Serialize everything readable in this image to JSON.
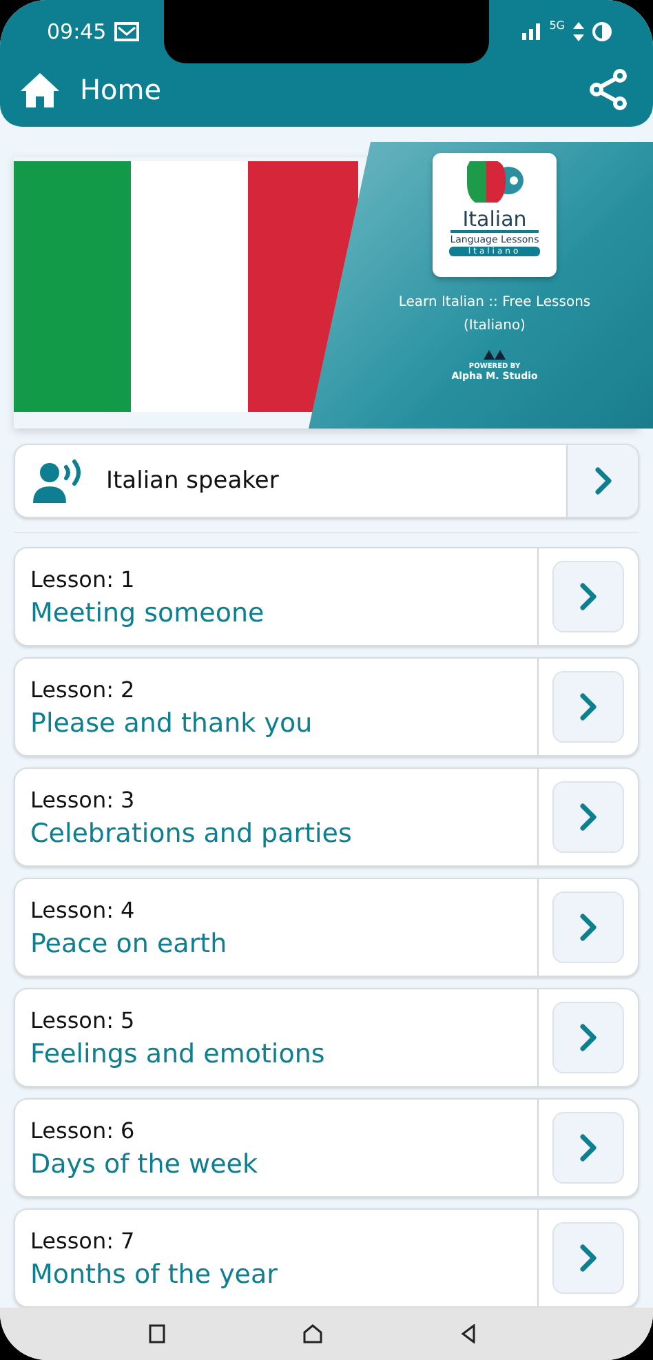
{
  "status_bar": {
    "time": "09:45",
    "network": "5G"
  },
  "app_bar": {
    "title": "Home"
  },
  "banner": {
    "logo_title": "Italian",
    "logo_subtitle": "Language Lessons",
    "logo_tag": "Italiano",
    "headline": "Learn Italian :: Free Lessons (Italiano)",
    "powered_label": "POWERED BY",
    "studio": "Alpha M. Studio"
  },
  "speaker": {
    "label": "Italian speaker"
  },
  "lessons": [
    {
      "number": "Lesson: 1",
      "title": "Meeting someone"
    },
    {
      "number": "Lesson: 2",
      "title": "Please and thank you"
    },
    {
      "number": "Lesson: 3",
      "title": "Celebrations and parties"
    },
    {
      "number": "Lesson: 4",
      "title": "Peace on earth"
    },
    {
      "number": "Lesson: 5",
      "title": "Feelings and emotions"
    },
    {
      "number": "Lesson: 6",
      "title": "Days of the week"
    },
    {
      "number": "Lesson: 7",
      "title": "Months of the year"
    }
  ]
}
